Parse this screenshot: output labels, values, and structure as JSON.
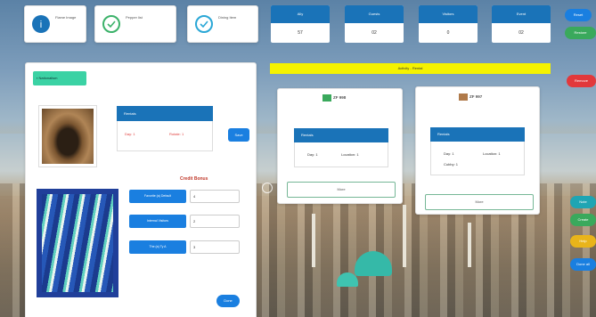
{
  "top_cards": [
    {
      "label": "Flame Image",
      "color": "#1a73b8",
      "icon": "info-icon"
    },
    {
      "label": "Pepper list",
      "color": "#3cb26a",
      "icon": "check-icon"
    },
    {
      "label": "Dining Item",
      "color": "#2aa7d6",
      "icon": "check-icon"
    }
  ],
  "stats": [
    {
      "header": "Ally",
      "value": "57"
    },
    {
      "header": "Guests",
      "value": "02"
    },
    {
      "header": "Visitors",
      "value": "0"
    },
    {
      "header": "Event",
      "value": "02"
    }
  ],
  "right_pills": [
    {
      "label": "Reset",
      "color": "#1a7fe0"
    },
    {
      "label": "Restore",
      "color": "#3aa95c"
    },
    {
      "label": "Remove",
      "color": "#e2383b"
    }
  ],
  "side_pills": [
    {
      "label": "Note",
      "color": "#1fa5b3"
    },
    {
      "label": "Create",
      "color": "#3aa95c"
    },
    {
      "label": "Help",
      "color": "#e9b41a"
    },
    {
      "label": "Done all",
      "color": "#1a7fe0"
    }
  ],
  "yellow_banner": "Activity - Rental",
  "left_panel": {
    "badge": "Nationalism",
    "card1": {
      "title": "Rentals",
      "key1": "Day: 1",
      "key2": "Rotate: 1",
      "button": "Save"
    },
    "form_title": "Credit Bonus",
    "form_rows": [
      {
        "label": "Favorite (a) Default",
        "value": "4"
      },
      {
        "label": "Internal Visitors",
        "value": "2"
      },
      {
        "label": "The (a) Ty A",
        "value": "3"
      }
    ],
    "submit": "Done"
  },
  "mid_card1": {
    "title": "ZF 998",
    "bar": "Rentals",
    "key1": "Day: 1",
    "key2": "Location: 1",
    "button": "More"
  },
  "mid_card2": {
    "title": "ZF 997",
    "bar": "Rentals",
    "key1": "Day: 1",
    "key2": "Location: 1",
    "key3": "Cubby: 1",
    "button": "More"
  }
}
